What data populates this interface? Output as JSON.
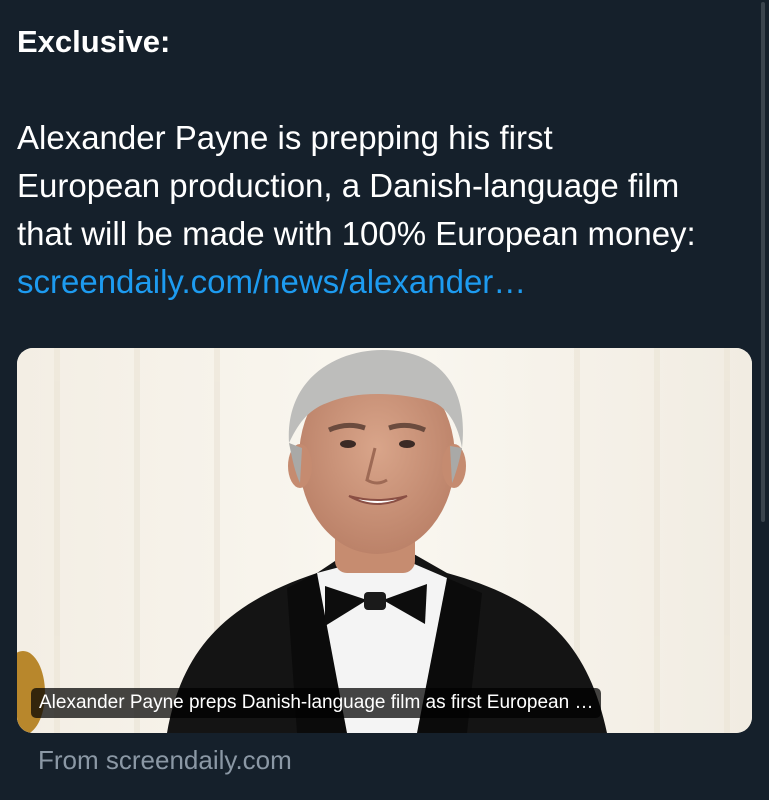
{
  "tweet": {
    "heading": "Exclusive:",
    "lines": [
      "Alexander Payne is prepping his first",
      "European production, a Danish-language film",
      "that will be made with 100% European money:"
    ],
    "link_text": "screendaily.com/news/alexander…"
  },
  "card": {
    "image_icon": "portrait-photo",
    "caption": "Alexander Payne preps Danish-language film as first European …",
    "source": "From screendaily.com"
  },
  "colors": {
    "background": "#15202b",
    "link": "#1d9bf0",
    "muted_text": "#8b98a5"
  }
}
